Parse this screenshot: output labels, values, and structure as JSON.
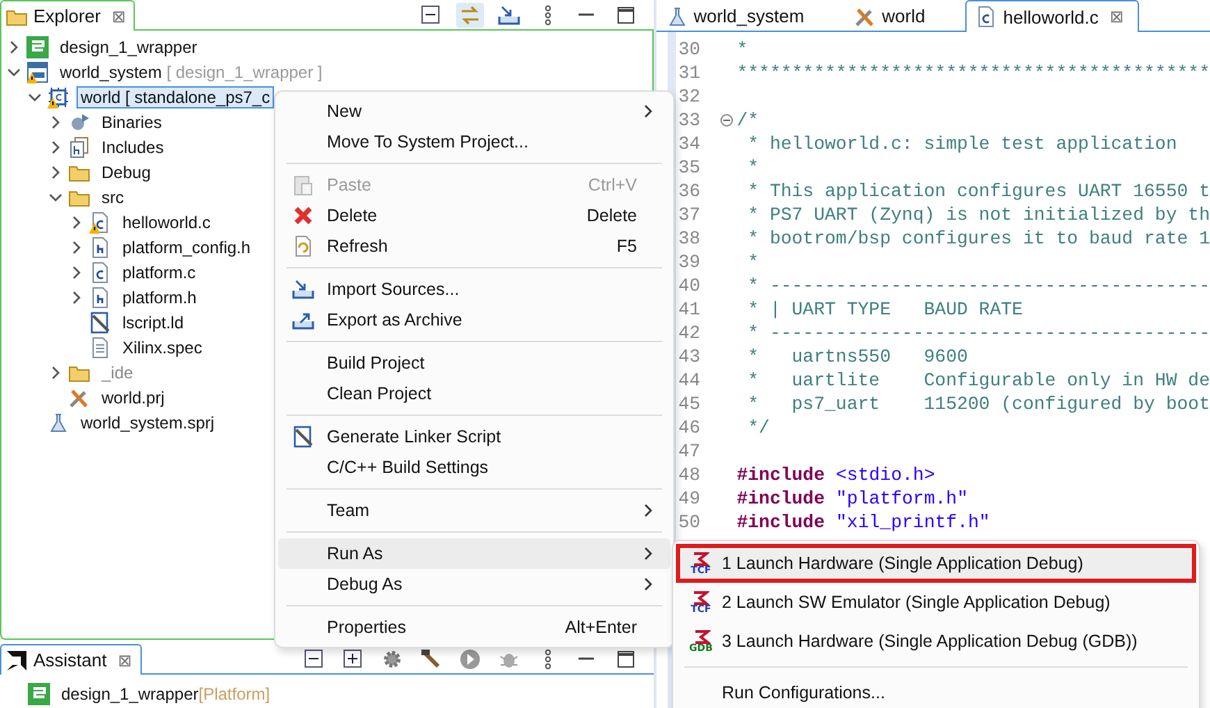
{
  "explorer": {
    "tab": {
      "label": "Explorer",
      "close": "⊠"
    },
    "toolbar": [
      {
        "kind": "collapse",
        "selected": false
      },
      {
        "kind": "link",
        "selected": true
      },
      {
        "kind": "import",
        "selected": false
      },
      {
        "kind": "more",
        "selected": false
      },
      {
        "kind": "minimize",
        "selected": false
      },
      {
        "kind": "maximize",
        "selected": false
      }
    ],
    "tree": [
      {
        "label": "design_1_wrapper",
        "kind": "platform",
        "expanded": false,
        "warning": false,
        "greyed": false,
        "selected": false
      },
      {
        "label": "world_system",
        "decoration": "[ design_1_wrapper ]",
        "kind": "system",
        "expanded": true,
        "warning": true,
        "greyed": false,
        "selected": false,
        "children": [
          {
            "label": "world [ standalone_ps7_c",
            "kind": "app",
            "expanded": true,
            "warning": true,
            "greyed": false,
            "selected": true,
            "children": [
              {
                "label": "Binaries",
                "kind": "binaries",
                "expanded": false,
                "warning": false,
                "greyed": false,
                "selected": false
              },
              {
                "label": "Includes",
                "kind": "includes",
                "expanded": false,
                "warning": false,
                "greyed": false,
                "selected": false
              },
              {
                "label": "Debug",
                "kind": "folder",
                "expanded": false,
                "warning": false,
                "greyed": false,
                "selected": false
              },
              {
                "label": "src",
                "kind": "folder",
                "expanded": true,
                "warning": false,
                "greyed": false,
                "selected": false,
                "children": [
                  {
                    "label": "helloworld.c",
                    "kind": "c-file",
                    "expanded": false,
                    "warning": true,
                    "greyed": false,
                    "selected": false
                  },
                  {
                    "label": "platform_config.h",
                    "kind": "h-file",
                    "expanded": false,
                    "warning": false,
                    "greyed": false,
                    "selected": false
                  },
                  {
                    "label": "platform.c",
                    "kind": "c-file",
                    "expanded": false,
                    "warning": false,
                    "greyed": false,
                    "selected": false
                  },
                  {
                    "label": "platform.h",
                    "kind": "h-file",
                    "expanded": false,
                    "warning": false,
                    "greyed": false,
                    "selected": false
                  },
                  {
                    "label": "lscript.ld",
                    "kind": "linker",
                    "warning": false,
                    "greyed": false,
                    "selected": false
                  },
                  {
                    "label": "Xilinx.spec",
                    "kind": "text-file",
                    "warning": false,
                    "greyed": false,
                    "selected": false
                  }
                ]
              },
              {
                "label": "_ide",
                "kind": "folder",
                "expanded": false,
                "warning": false,
                "greyed": true,
                "selected": false
              },
              {
                "label": "world.prj",
                "kind": "tools",
                "warning": false,
                "greyed": false,
                "selected": false
              }
            ]
          },
          {
            "label": "world_system.sprj",
            "kind": "flask",
            "warning": false,
            "greyed": false,
            "selected": false
          }
        ]
      }
    ]
  },
  "assistant": {
    "tab": {
      "label": "Assistant",
      "close": "⊠"
    },
    "toolbar": [
      {
        "kind": "collapse"
      },
      {
        "kind": "expand"
      },
      {
        "kind": "gear"
      },
      {
        "kind": "hammer"
      },
      {
        "kind": "run"
      },
      {
        "kind": "bug"
      },
      {
        "kind": "more"
      },
      {
        "kind": "minimize"
      },
      {
        "kind": "maximize"
      }
    ],
    "tree": [
      {
        "label": "design_1_wrapper",
        "decoration": "[Platform]",
        "kind": "platform"
      }
    ]
  },
  "editor": {
    "tabs": [
      {
        "label": "world_system",
        "kind": "flask",
        "selected": false
      },
      {
        "label": "world",
        "kind": "tools",
        "selected": false
      },
      {
        "label": "helloworld.c",
        "kind": "c-file",
        "selected": true,
        "close": "⊠"
      }
    ],
    "lines": [
      {
        "number": "30",
        "kind": "comment",
        "text": "*"
      },
      {
        "number": "31",
        "kind": "comment",
        "text": "*******************************************"
      },
      {
        "number": "32",
        "kind": "blank"
      },
      {
        "number": "33",
        "kind": "comment",
        "text": "/*",
        "folded": false
      },
      {
        "number": "34",
        "kind": "comment",
        "text": " * helloworld.c: simple test application"
      },
      {
        "number": "35",
        "kind": "comment",
        "text": " *"
      },
      {
        "number": "36",
        "kind": "comment",
        "text": " * This application configures UART 16550 t"
      },
      {
        "number": "37",
        "kind": "comment",
        "text": " * PS7 UART (Zynq) is not initialized by th"
      },
      {
        "number": "38",
        "kind": "comment",
        "text": " * bootrom/bsp configures it to baud rate 1"
      },
      {
        "number": "39",
        "kind": "comment",
        "text": " *"
      },
      {
        "number": "40",
        "kind": "comment",
        "text": " * ----------------------------------------"
      },
      {
        "number": "41",
        "kind": "comment",
        "text": " * | UART TYPE   BAUD RATE"
      },
      {
        "number": "42",
        "kind": "comment",
        "text": " * ----------------------------------------"
      },
      {
        "number": "43",
        "kind": "comment",
        "text": " *   uartns550   9600"
      },
      {
        "number": "44",
        "kind": "comment",
        "text": " *   uartlite    Configurable only in HW de"
      },
      {
        "number": "45",
        "kind": "comment",
        "text": " *   ps7_uart    115200 (configured by boot"
      },
      {
        "number": "46",
        "kind": "comment",
        "text": " */"
      },
      {
        "number": "47",
        "kind": "blank"
      },
      {
        "number": "48",
        "kind": "include",
        "keyword": "#include",
        "text": "<stdio.h>"
      },
      {
        "number": "49",
        "kind": "include",
        "keyword": "#include",
        "text": "\"platform.h\""
      },
      {
        "number": "50",
        "kind": "include",
        "keyword": "#include",
        "text": "\"xil_printf.h\""
      }
    ]
  },
  "context_menu": [
    {
      "kind": "item",
      "label": "New",
      "submenu": true,
      "disabled": false,
      "selected": false
    },
    {
      "kind": "item",
      "label": "Move To System Project...",
      "submenu": false,
      "disabled": false,
      "selected": false
    },
    {
      "kind": "separator"
    },
    {
      "kind": "paste",
      "label": "Paste",
      "shortcut": "Ctrl+V",
      "submenu": false,
      "disabled": true,
      "selected": false
    },
    {
      "kind": "delete",
      "label": "Delete",
      "shortcut": "Delete",
      "submenu": false,
      "disabled": false,
      "selected": false
    },
    {
      "kind": "refresh",
      "label": "Refresh",
      "shortcut": "F5",
      "submenu": false,
      "disabled": false,
      "selected": false
    },
    {
      "kind": "separator"
    },
    {
      "kind": "import",
      "label": "Import Sources...",
      "submenu": false,
      "disabled": false,
      "selected": false
    },
    {
      "kind": "export",
      "label": "Export as Archive",
      "submenu": false,
      "disabled": false,
      "selected": false
    },
    {
      "kind": "separator"
    },
    {
      "kind": "item",
      "label": "Build Project",
      "submenu": false,
      "disabled": false,
      "selected": false
    },
    {
      "kind": "item",
      "label": "Clean Project",
      "submenu": false,
      "disabled": false,
      "selected": false
    },
    {
      "kind": "separator"
    },
    {
      "kind": "linker",
      "label": "Generate Linker Script",
      "submenu": false,
      "disabled": false,
      "selected": false
    },
    {
      "kind": "item",
      "label": "C/C++ Build Settings",
      "submenu": false,
      "disabled": false,
      "selected": false
    },
    {
      "kind": "separator"
    },
    {
      "kind": "item",
      "label": "Team",
      "submenu": true,
      "disabled": false,
      "selected": false
    },
    {
      "kind": "separator"
    },
    {
      "kind": "item",
      "label": "Run As",
      "submenu": true,
      "disabled": false,
      "selected": true
    },
    {
      "kind": "item",
      "label": "Debug As",
      "submenu": true,
      "disabled": false,
      "selected": false
    },
    {
      "kind": "separator"
    },
    {
      "kind": "item",
      "label": "Properties",
      "shortcut": "Alt+Enter",
      "submenu": false,
      "disabled": false,
      "selected": false
    }
  ],
  "run_as_menu": [
    {
      "kind": "launch",
      "label": "1 Launch Hardware (Single Application Debug)",
      "icon_caption": "TCF",
      "color": "#1a3fc0",
      "selected": true,
      "highlighted": true
    },
    {
      "kind": "launch",
      "label": "2 Launch SW Emulator (Single Application Debug)",
      "icon_caption": "TCF",
      "color": "#1a3fc0",
      "selected": false,
      "highlighted": false
    },
    {
      "kind": "launch",
      "label": "3 Launch Hardware (Single Application Debug (GDB))",
      "icon_caption": "GDB",
      "color": "#137a1e",
      "selected": false,
      "highlighted": false
    },
    {
      "kind": "separator"
    },
    {
      "kind": "item",
      "label": "Run Configurations...",
      "selected": false,
      "highlighted": false
    }
  ]
}
